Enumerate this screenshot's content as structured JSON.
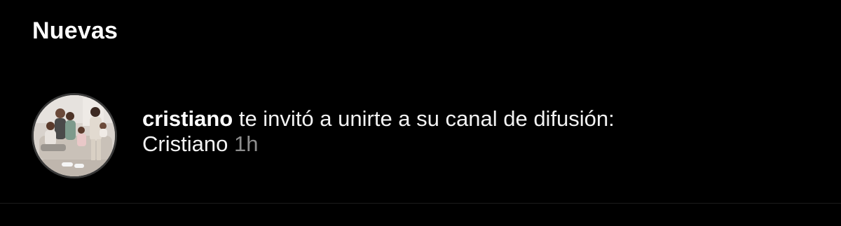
{
  "section": {
    "title": "Nuevas"
  },
  "notification": {
    "username": "cristiano",
    "message": " te invitó a unirte a su canal de difusión:",
    "channel_name": "Cristiano",
    "time": "1h",
    "avatar_icon": "profile-photo-avatar"
  },
  "colors": {
    "background": "#000000",
    "text": "#ffffff",
    "secondary_text": "#8e8e8e"
  }
}
